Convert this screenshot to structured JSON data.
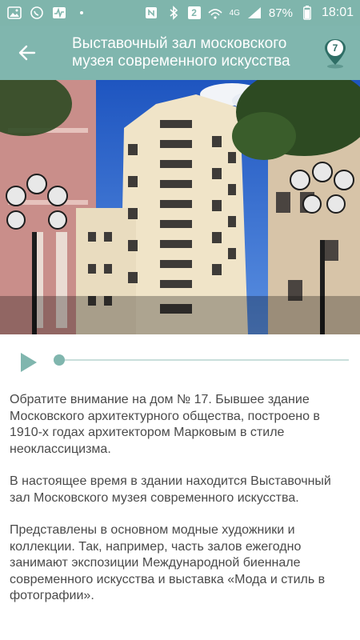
{
  "status_bar": {
    "battery_percent": "87%",
    "time": "18:01",
    "notification_count": "2",
    "network": "4G",
    "icons": [
      "photo-icon",
      "whatsapp-icon",
      "activity-icon",
      "dot-icon",
      "nfc-icon",
      "bluetooth-icon",
      "notification-badge-icon",
      "wifi-icon",
      "signal-icon",
      "battery-icon"
    ]
  },
  "app_bar": {
    "title_line1": "Выставочный зал московского",
    "title_line2": "музея современного искусства",
    "pin_number": "7"
  },
  "player": {
    "progress": 0.0
  },
  "description": {
    "paragraphs": [
      "Обратите внимание на дом № 17. Бывшее здание Московского архитектурного общества, построено в 1910-х годах архитектором Марковым в стиле неоклассицизма.",
      "В настоящее время в здании находится Выставочный зал Московского музея современного искусства.",
      "Представлены в основном модные художники и коллекции. Так, например, часть залов ежегодно занимают экспозиции Международной биеннале современного искусства и выставка «Мода и стиль в фотографии»."
    ]
  },
  "colors": {
    "accent": "#80b6ae",
    "status_bar": "#7fb5ac",
    "text": "#4a4a4a",
    "sky": "#2b63c8"
  }
}
